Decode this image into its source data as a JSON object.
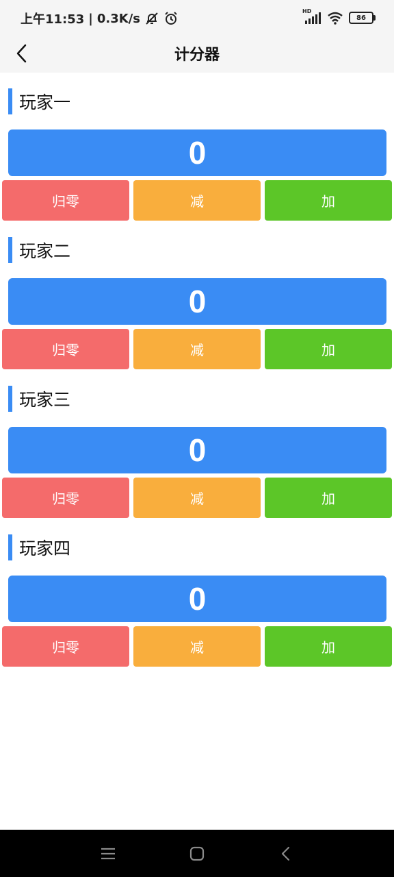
{
  "status_bar": {
    "time": "上午11:53",
    "separator": "|",
    "net_speed": "0.3K/s",
    "signal_label": "HD",
    "battery": "86"
  },
  "header": {
    "title": "计分器"
  },
  "players": [
    {
      "name": "玩家一",
      "score": "0",
      "reset_label": "归零",
      "minus_label": "减",
      "plus_label": "加"
    },
    {
      "name": "玩家二",
      "score": "0",
      "reset_label": "归零",
      "minus_label": "减",
      "plus_label": "加"
    },
    {
      "name": "玩家三",
      "score": "0",
      "reset_label": "归零",
      "minus_label": "减",
      "plus_label": "加"
    },
    {
      "name": "玩家四",
      "score": "0",
      "reset_label": "归零",
      "minus_label": "减",
      "plus_label": "加"
    }
  ],
  "colors": {
    "accent": "#3a8cf4",
    "reset": "#f46b6b",
    "minus": "#f9ae3d",
    "plus": "#5cc628"
  },
  "icons": {
    "back": "chevron-left-icon",
    "mute": "mute-bell-icon",
    "alarm": "alarm-icon",
    "signal": "signal-icon",
    "wifi": "wifi-icon",
    "battery": "battery-icon",
    "nav_menu": "menu-icon",
    "nav_home": "home-icon",
    "nav_back": "back-icon"
  }
}
